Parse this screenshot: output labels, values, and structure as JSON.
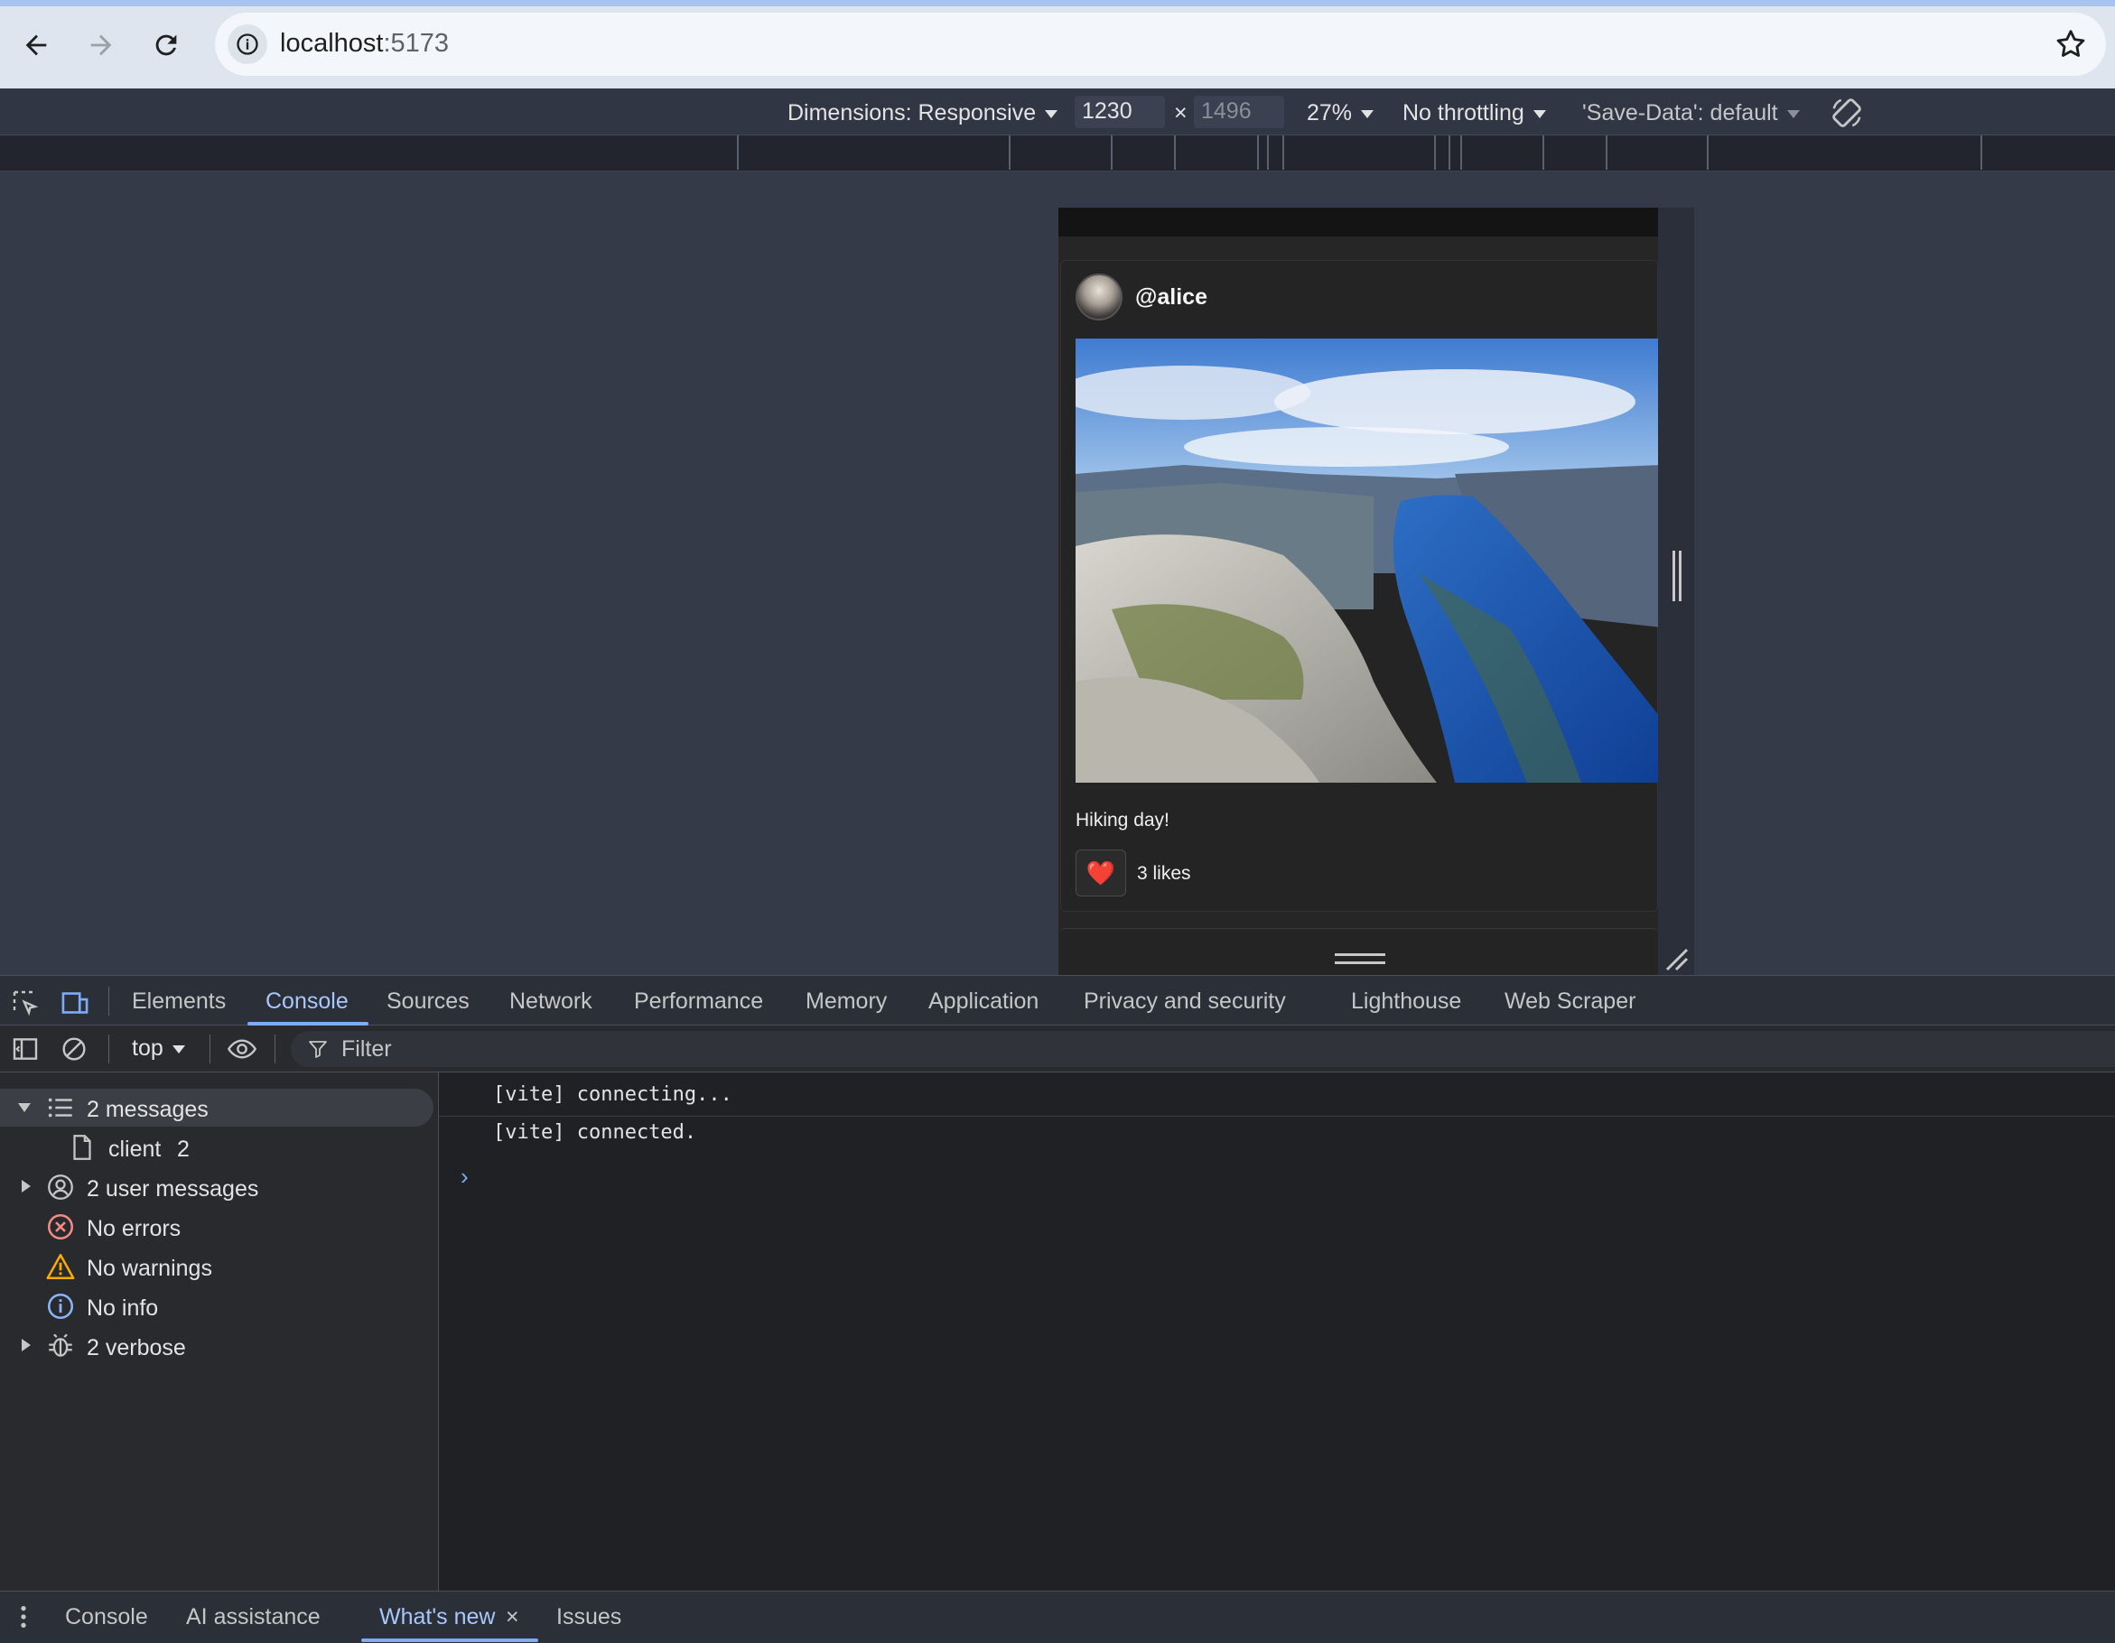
{
  "browser": {
    "url_host": "localhost",
    "url_port": ":5173"
  },
  "device_toolbar": {
    "dimensions_label": "Dimensions: Responsive",
    "width_value": "1230",
    "times": "×",
    "height_value": "1496",
    "zoom": "27%",
    "throttling": "No throttling",
    "save_data": "'Save-Data': default"
  },
  "post": {
    "username": "@alice",
    "caption": "Hiking day!",
    "like_emoji": "❤️",
    "likes_text": "3 likes"
  },
  "devtools": {
    "tabs": [
      "Elements",
      "Console",
      "Sources",
      "Network",
      "Performance",
      "Memory",
      "Application",
      "Privacy and security",
      "Lighthouse",
      "Web Scraper"
    ],
    "active_tab": "Console",
    "console_toolbar": {
      "context": "top",
      "filter_placeholder": "Filter"
    },
    "sidebar": {
      "items": [
        {
          "label": "2 messages",
          "icon": "list-icon"
        },
        {
          "label": "client",
          "count": "2",
          "icon": "file-icon"
        },
        {
          "label": "2 user messages",
          "icon": "user-circle-icon"
        },
        {
          "label": "No errors",
          "icon": "error-icon"
        },
        {
          "label": "No warnings",
          "icon": "warning-icon"
        },
        {
          "label": "No info",
          "icon": "info-icon"
        },
        {
          "label": "2 verbose",
          "icon": "bug-icon"
        }
      ]
    },
    "log": [
      "[vite] connecting...",
      "[vite] connected."
    ],
    "prompt": "›",
    "drawer_tabs": [
      "Console",
      "AI assistance",
      "What's new",
      "Issues"
    ],
    "drawer_close": "×"
  },
  "colors": {
    "accent": "#7cacf8",
    "error": "#f28b82",
    "warning": "#f9ab00",
    "info": "#8ab4f8"
  }
}
